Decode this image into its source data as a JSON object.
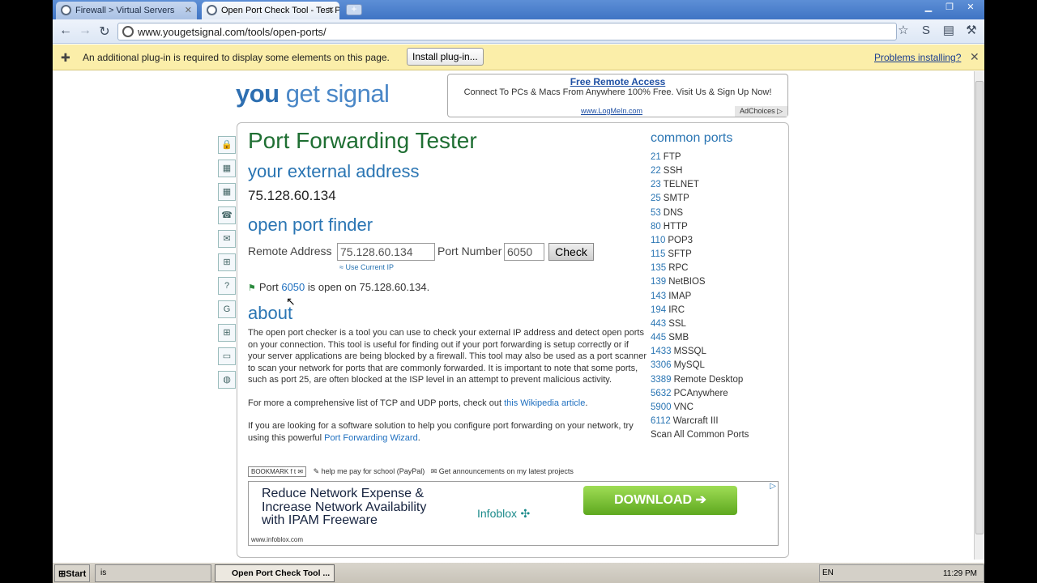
{
  "browser": {
    "tabs": [
      {
        "title": "Firewall > Virtual Servers"
      },
      {
        "title": "Open Port Check Tool - Test P..."
      }
    ],
    "new_tab": "+",
    "url": "www.yougetsignal.com/tools/open-ports/"
  },
  "infobar": {
    "message": "An additional plug-in is required to display some elements on this page.",
    "install_label": "Install plug-in...",
    "problems_label": "Problems installing?",
    "close": "✕"
  },
  "site": {
    "logo_a": "you",
    "logo_b": " get signal"
  },
  "top_ad": {
    "headline": "Free Remote Access",
    "body": "Connect To PCs & Macs From Anywhere 100% Free. Visit Us & Sign Up Now!",
    "url": "www.LogMeIn.com",
    "adchoices": "AdChoices ▷"
  },
  "page": {
    "title": "Port Forwarding Tester",
    "external_heading": "your external address",
    "external_ip": "75.128.60.134",
    "finder_heading": "open port finder",
    "remote_label": "Remote Address",
    "remote_value": "75.128.60.134",
    "port_label": "Port Number",
    "port_value": "6050",
    "check_label": "Check",
    "use_current": "≈ Use Current IP",
    "result_prefix": "Port ",
    "result_port": "6050",
    "result_suffix": " is open on 75.128.60.134.",
    "about_heading": "about",
    "about_p1": "The open port checker is a tool you can use to check your external IP address and detect open ports on your connection. This tool is useful for finding out if your port forwarding is setup correctly or if your server applications are being blocked by a firewall. This tool may also be used as a port scanner to scan your network for ports that are commonly forwarded. It is important to note that some ports, such as port 25, are often blocked at the ISP level in an attempt to prevent malicious activity.",
    "about_p2_pre": "For more a comprehensive list of TCP and UDP ports, check out ",
    "about_p2_link": "this Wikipedia article",
    "about_p2_post": ".",
    "about_p3_pre": "If you are looking for a software solution to help you configure port forwarding on your network, try using this powerful ",
    "about_p3_link": "Port Forwarding Wizard",
    "about_p3_post": ".",
    "bookmark": "BOOKMARK",
    "paypal": "help me pay for school (PayPal)",
    "announce": "Get announcements on my latest projects"
  },
  "bottom_ad": {
    "text_line1": "Reduce Network Expense &",
    "text_line2": "Increase Network Availability",
    "text_line3": "with IPAM Freeware",
    "brand": "Infoblox",
    "download": "DOWNLOAD ➔",
    "url": "www.infoblox.com"
  },
  "common_ports": {
    "heading": "common ports",
    "items": [
      {
        "num": "21",
        "name": "FTP"
      },
      {
        "num": "22",
        "name": "SSH"
      },
      {
        "num": "23",
        "name": "TELNET"
      },
      {
        "num": "25",
        "name": "SMTP"
      },
      {
        "num": "53",
        "name": "DNS"
      },
      {
        "num": "80",
        "name": "HTTP"
      },
      {
        "num": "110",
        "name": "POP3"
      },
      {
        "num": "115",
        "name": "SFTP"
      },
      {
        "num": "135",
        "name": "RPC"
      },
      {
        "num": "139",
        "name": "NetBIOS"
      },
      {
        "num": "143",
        "name": "IMAP"
      },
      {
        "num": "194",
        "name": "IRC"
      },
      {
        "num": "443",
        "name": "SSL"
      },
      {
        "num": "445",
        "name": "SMB"
      },
      {
        "num": "1433",
        "name": "MSSQL"
      },
      {
        "num": "3306",
        "name": "MySQL"
      },
      {
        "num": "3389",
        "name": "Remote Desktop"
      },
      {
        "num": "5632",
        "name": "PCAnywhere"
      },
      {
        "num": "5900",
        "name": "VNC"
      },
      {
        "num": "6112",
        "name": "Warcraft III"
      }
    ],
    "scan_all": "Scan All Common Ports"
  },
  "taskbar": {
    "start": "Start",
    "task1": "is",
    "task2": "Open Port Check Tool ...",
    "tray_lang": "EN",
    "clock": "11:29 PM"
  }
}
